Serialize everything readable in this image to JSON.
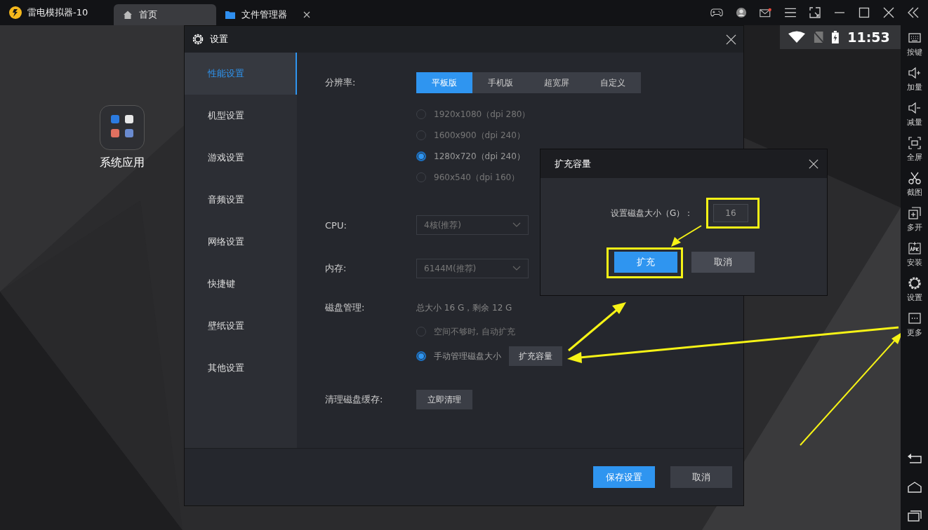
{
  "titlebar": {
    "app_title": "雷电模拟器-10",
    "tabs": [
      {
        "label": "首页",
        "selected": true,
        "kind": "home",
        "closable": false
      },
      {
        "label": "文件管理器",
        "selected": false,
        "kind": "folder",
        "closable": true
      }
    ]
  },
  "android_status": {
    "time": "11:53"
  },
  "desktop": {
    "icons": [
      {
        "label": "系统应用"
      }
    ]
  },
  "sidebar": {
    "items": [
      {
        "label": "按键",
        "kind": "keyboard"
      },
      {
        "label": "加量",
        "kind": "volume_up"
      },
      {
        "label": "减量",
        "kind": "volume_down"
      },
      {
        "label": "全屏",
        "kind": "fullscreen"
      },
      {
        "label": "截图",
        "kind": "scissors"
      },
      {
        "label": "多开",
        "kind": "multi"
      },
      {
        "label": "安装",
        "kind": "apk"
      },
      {
        "label": "设置",
        "kind": "settings"
      },
      {
        "label": "更多",
        "kind": "more"
      }
    ],
    "nav_buttons": [
      {
        "kind": "back"
      },
      {
        "kind": "home"
      },
      {
        "kind": "recent"
      }
    ]
  },
  "settings": {
    "title": "设置",
    "nav": [
      {
        "label": "性能设置",
        "selected": true
      },
      {
        "label": "机型设置",
        "selected": false
      },
      {
        "label": "游戏设置",
        "selected": false
      },
      {
        "label": "音频设置",
        "selected": false
      },
      {
        "label": "网络设置",
        "selected": false
      },
      {
        "label": "快捷键",
        "selected": false
      },
      {
        "label": "壁纸设置",
        "selected": false
      },
      {
        "label": "其他设置",
        "selected": false
      }
    ],
    "resolution": {
      "label": "分辨率:",
      "modes": [
        {
          "label": "平板版",
          "selected": true
        },
        {
          "label": "手机版",
          "selected": false
        },
        {
          "label": "超宽屏",
          "selected": false
        },
        {
          "label": "自定义",
          "selected": false
        }
      ],
      "options": [
        {
          "label": "1920x1080（dpi 280）",
          "selected": false
        },
        {
          "label": "1600x900（dpi 240）",
          "selected": false
        },
        {
          "label": "1280x720（dpi 240）",
          "selected": true
        },
        {
          "label": "960x540（dpi 160）",
          "selected": false
        }
      ]
    },
    "cpu": {
      "label": "CPU:",
      "value": "4核(推荐)"
    },
    "memory": {
      "label": "内存:",
      "value": "6144M(推荐)"
    },
    "disk": {
      "label": "磁盘管理:",
      "summary": "总大小 16 G，剩余 12 G",
      "options": [
        {
          "label": "空间不够时, 自动扩充",
          "selected": false
        },
        {
          "label": "手动管理磁盘大小",
          "selected": true
        }
      ],
      "expand_button": "扩充容量"
    },
    "cache": {
      "label": "清理磁盘缓存:",
      "button": "立即清理"
    },
    "buttons": [
      {
        "label": "保存设置",
        "kind": "primary"
      },
      {
        "label": "取消",
        "kind": "secondary"
      }
    ]
  },
  "expand_dialog": {
    "title": "扩充容量",
    "field_label": "设置磁盘大小（G）：",
    "value": "16",
    "buttons": [
      {
        "label": "扩充",
        "kind": "primary"
      },
      {
        "label": "取消",
        "kind": "secondary"
      }
    ]
  }
}
